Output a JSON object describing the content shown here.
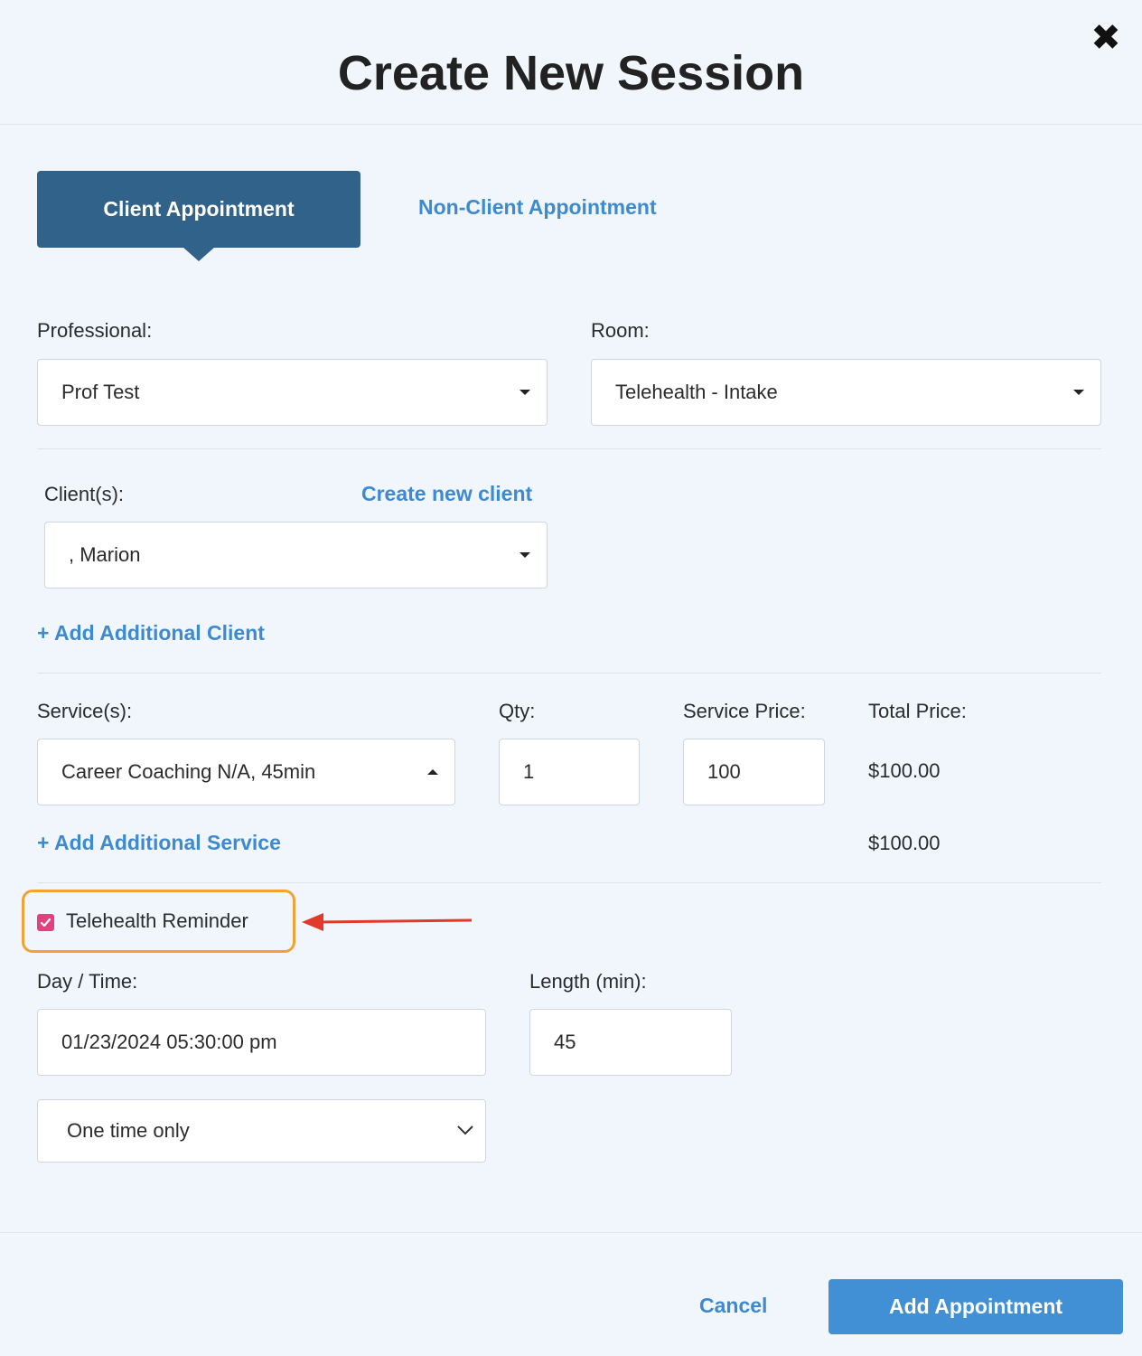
{
  "header": {
    "title": "Create New Session",
    "close_icon": "close-icon"
  },
  "tabs": {
    "active": "Client Appointment",
    "inactive": "Non-Client Appointment"
  },
  "professional": {
    "label": "Professional:",
    "value": "Prof Test"
  },
  "room": {
    "label": "Room:",
    "value": "Telehealth - Intake"
  },
  "clients": {
    "label": "Client(s):",
    "create_link": "Create new client",
    "value": ", Marion",
    "add_link": "+ Add Additional Client"
  },
  "services": {
    "service_label": "Service(s):",
    "qty_label": "Qty:",
    "price_label": "Service Price:",
    "total_label": "Total Price:",
    "service_value": "Career Coaching N/A, 45min",
    "qty_value": "1",
    "price_value": "100",
    "total_value": "$100.00",
    "add_link": "+ Add Additional Service",
    "grand_total": "$100.00"
  },
  "reminder": {
    "label": "Telehealth Reminder",
    "checked": true,
    "checkbox_color": "#e2417d",
    "highlight_color": "#f0a232",
    "arrow_color": "#e03a2a"
  },
  "schedule": {
    "daytime_label": "Day / Time:",
    "daytime_value": "01/23/2024 05:30:00 pm",
    "length_label": "Length (min):",
    "length_value": "45",
    "recurrence_value": "One time only"
  },
  "footer": {
    "cancel": "Cancel",
    "submit": "Add Appointment"
  },
  "colors": {
    "accent": "#3d8ad1",
    "tab_active": "#316289",
    "primary_button": "#418fd4",
    "background": "#f0f6fc"
  }
}
